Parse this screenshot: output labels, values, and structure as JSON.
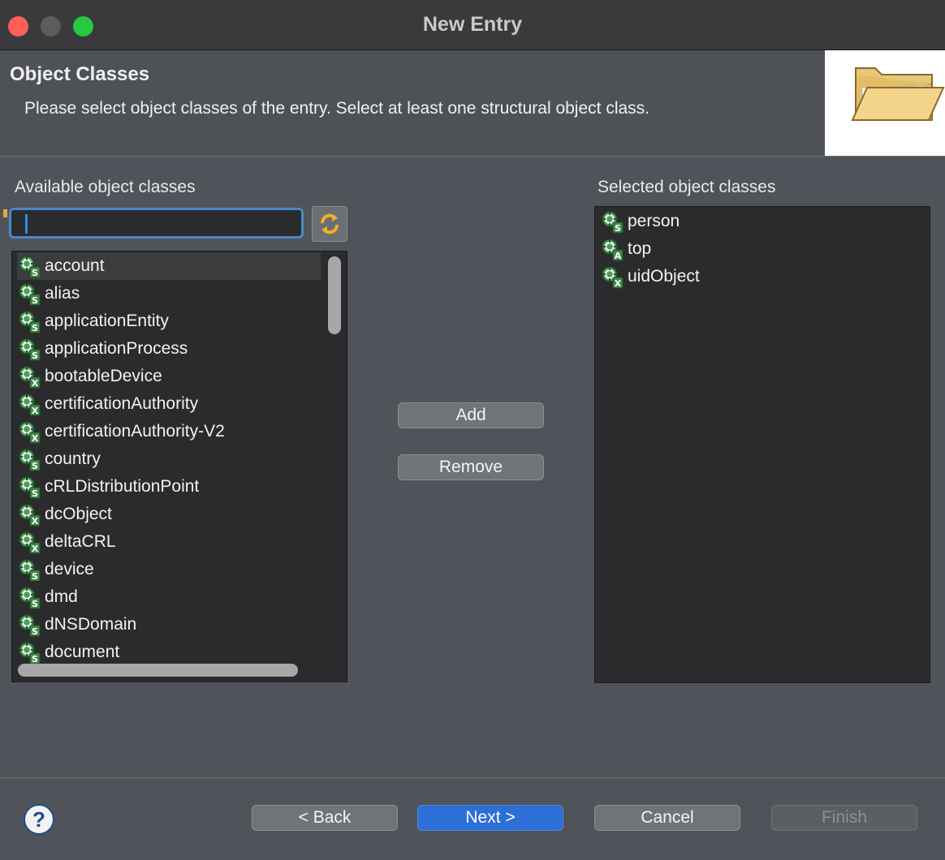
{
  "window": {
    "title": "New Entry"
  },
  "header": {
    "title": "Object Classes",
    "description": "Please select object classes of the entry. Select at least one structural object class."
  },
  "available": {
    "label": "Available object classes",
    "filter_value": "",
    "items": [
      {
        "label": "account",
        "icon": "structural-objectclass-icon",
        "badge": "S"
      },
      {
        "label": "alias",
        "icon": "structural-objectclass-icon",
        "badge": "S"
      },
      {
        "label": "applicationEntity",
        "icon": "structural-objectclass-icon",
        "badge": "S"
      },
      {
        "label": "applicationProcess",
        "icon": "structural-objectclass-icon",
        "badge": "S"
      },
      {
        "label": "bootableDevice",
        "icon": "auxiliary-objectclass-icon",
        "badge": "X"
      },
      {
        "label": "certificationAuthority",
        "icon": "auxiliary-objectclass-icon",
        "badge": "X"
      },
      {
        "label": "certificationAuthority-V2",
        "icon": "auxiliary-objectclass-icon",
        "badge": "X"
      },
      {
        "label": "country",
        "icon": "structural-objectclass-icon",
        "badge": "S"
      },
      {
        "label": "cRLDistributionPoint",
        "icon": "structural-objectclass-icon",
        "badge": "S"
      },
      {
        "label": "dcObject",
        "icon": "auxiliary-objectclass-icon",
        "badge": "X"
      },
      {
        "label": "deltaCRL",
        "icon": "auxiliary-objectclass-icon",
        "badge": "X"
      },
      {
        "label": "device",
        "icon": "structural-objectclass-icon",
        "badge": "S"
      },
      {
        "label": "dmd",
        "icon": "structural-objectclass-icon",
        "badge": "S"
      },
      {
        "label": "dNSDomain",
        "icon": "structural-objectclass-icon",
        "badge": "S"
      },
      {
        "label": "document",
        "icon": "structural-objectclass-icon",
        "badge": "S"
      }
    ]
  },
  "selected": {
    "label": "Selected object classes",
    "items": [
      {
        "label": "person",
        "icon": "structural-objectclass-icon",
        "badge": "S"
      },
      {
        "label": "top",
        "icon": "abstract-objectclass-icon",
        "badge": "A"
      },
      {
        "label": "uidObject",
        "icon": "auxiliary-objectclass-icon",
        "badge": "X"
      }
    ]
  },
  "buttons": {
    "add": "Add",
    "remove": "Remove",
    "back": "< Back",
    "next": "Next >",
    "cancel": "Cancel",
    "finish": "Finish",
    "help": "?"
  }
}
